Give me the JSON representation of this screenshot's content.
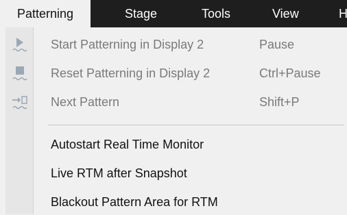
{
  "menubar": {
    "tabs": [
      "Patterning",
      "Stage",
      "Tools",
      "View",
      "H"
    ]
  },
  "menu": {
    "items": [
      {
        "label": "Start Patterning in Display 2",
        "shortcut": "Pause",
        "icon": "play-icon",
        "enabled": false
      },
      {
        "label": "Reset Patterning in Display 2",
        "shortcut": "Ctrl+Pause",
        "icon": "stop-icon",
        "enabled": false
      },
      {
        "label": "Next Pattern",
        "shortcut": "Shift+P",
        "icon": "next-pattern-icon",
        "enabled": false
      },
      {
        "label": "Autostart Real Time Monitor",
        "shortcut": "",
        "enabled": true
      },
      {
        "label": "Live RTM after Snapshot",
        "shortcut": "",
        "enabled": true
      },
      {
        "label": "Blackout Pattern Area for RTM",
        "shortcut": "",
        "enabled": true
      }
    ]
  },
  "colors": {
    "menubar_bg": "#1e1e1e",
    "menu_bg": "#f0f0f0",
    "disabled_text": "#7a7a7a",
    "disabled_icon": "#9aa8b5"
  }
}
